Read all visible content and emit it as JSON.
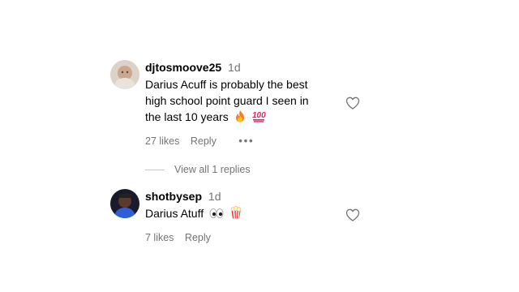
{
  "comments": [
    {
      "username": "djtosmoove25",
      "time": "1d",
      "lines": [
        "Darius Acuff is probably the best",
        "high school point guard I seen in",
        "the last 10 years"
      ],
      "emojis": [
        "fire",
        "hundred"
      ],
      "likes": "27 likes",
      "reply": "Reply",
      "more": "•••"
    },
    {
      "username": "shotbysep",
      "time": "1d",
      "lines": [
        "Darius Atuff"
      ],
      "emojis": [
        "eyes",
        "popcorn"
      ],
      "likes": "7 likes",
      "reply": "Reply"
    }
  ],
  "view_replies": "View all 1 replies",
  "colors": {
    "secondary_text": "#737373",
    "divider": "#c7c7c7"
  }
}
